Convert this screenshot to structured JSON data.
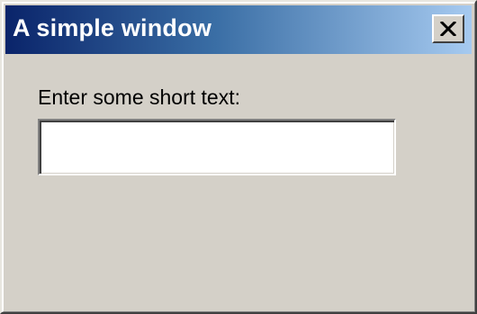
{
  "window": {
    "title": "A simple window",
    "close_label": "close",
    "close_icon": "close-icon"
  },
  "form": {
    "label": "Enter some short text:",
    "input_value": "",
    "input_placeholder": ""
  },
  "colors": {
    "titlebar_start": "#0a246a",
    "titlebar_end": "#a6caf0",
    "window_face": "#d4d0c8"
  }
}
